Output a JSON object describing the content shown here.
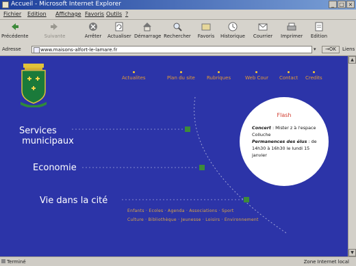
{
  "window": {
    "title": "Accueil - Microsoft Internet Explorer"
  },
  "menu": [
    "Fichier",
    "Edition",
    "Affichage",
    "Favoris",
    "Outils",
    "?"
  ],
  "toolbar": [
    {
      "label": "Précédente",
      "icon": "back-arrow-icon"
    },
    {
      "label": "Suivante",
      "icon": "forward-arrow-icon"
    },
    {
      "label": "Arrêter",
      "icon": "stop-icon"
    },
    {
      "label": "Actualiser",
      "icon": "refresh-icon"
    },
    {
      "label": "Démarrage",
      "icon": "home-icon"
    },
    {
      "label": "Rechercher",
      "icon": "search-icon"
    },
    {
      "label": "Favoris",
      "icon": "favorites-icon"
    },
    {
      "label": "Historique",
      "icon": "history-icon"
    },
    {
      "label": "Courrier",
      "icon": "mail-icon"
    },
    {
      "label": "Imprimer",
      "icon": "printer-icon"
    },
    {
      "label": "Edition",
      "icon": "edit-icon"
    }
  ],
  "address": {
    "label": "Adresse",
    "url": "www.maisons-alfort-le-lamare.fr",
    "go": "OK",
    "links": "Liens"
  },
  "status": {
    "left": "Terminé",
    "right": "Zone Internet local"
  },
  "site": {
    "topnav": [
      "Actualites",
      "Plan du site",
      "Rubriques",
      "Web Cour",
      "Contact",
      "Credits"
    ],
    "main_links": [
      {
        "label": "Services\n municipaux"
      },
      {
        "label": "Economie"
      },
      {
        "label": "Vie dans la cité"
      }
    ],
    "sub_lines": [
      "Enfants · Ecoles · Agenda · Associations · Sport",
      "Culture · Bibliothèque · Jeunesse · Loisirs · Environnement"
    ],
    "flash": {
      "title": "Flash",
      "concert_label": "Concert",
      "concert_text": " : Mister z à l'espace Colluche",
      "perm_label": "Permanences des élus",
      "perm_text": " : de 14h30 à 16h30 le lundi 15 janvier"
    }
  },
  "colors": {
    "site_bg": "#2c34a8",
    "nav_text": "#e59a34",
    "link_text": "#ffffff",
    "node_green": "#3d8a3a",
    "flash_title": "#d13a2c"
  }
}
